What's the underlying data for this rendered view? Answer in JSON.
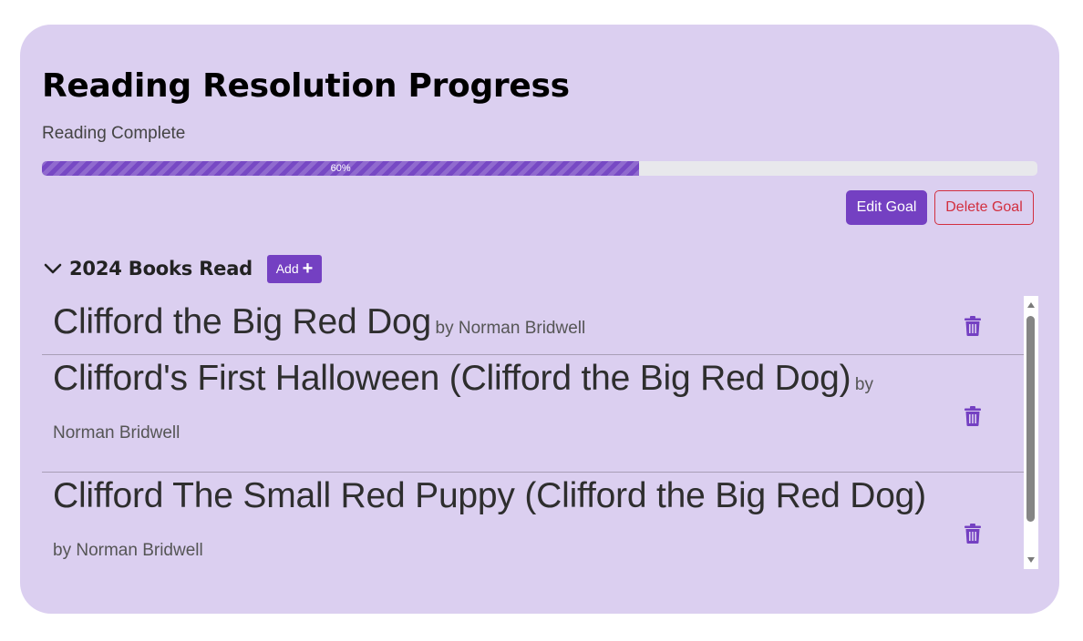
{
  "header": {
    "title": "Reading Resolution Progress",
    "subtitle": "Reading Complete"
  },
  "progress": {
    "value": 60,
    "label": "60%",
    "color": "#7749c4"
  },
  "actions": {
    "edit_label": "Edit Goal",
    "delete_label": "Delete Goal"
  },
  "section": {
    "title": "2024 Books Read",
    "add_label": "Add",
    "add_icon": "plus-icon",
    "collapse_icon": "chevron-down-icon"
  },
  "books": [
    {
      "title": "Clifford the Big Red Dog",
      "author": "by Norman Bridwell",
      "icon": "trash-icon"
    },
    {
      "title": "Clifford's First Halloween (Clifford the Big Red Dog)",
      "author": "by Norman Bridwell",
      "icon": "trash-icon"
    },
    {
      "title": "Clifford The Small Red Puppy (Clifford the Big Red Dog)",
      "author": "by Norman Bridwell",
      "icon": "trash-icon"
    }
  ],
  "colors": {
    "accent": "#7440c2",
    "danger": "#d22f3f",
    "card_background": "#dbcff0"
  }
}
